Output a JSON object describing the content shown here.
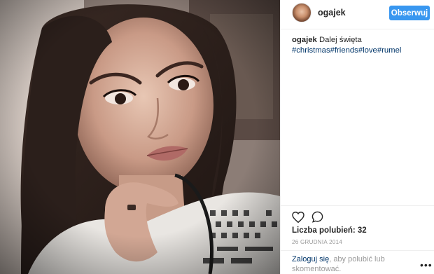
{
  "post": {
    "username": "ogajek",
    "follow_label": "Obserwuj",
    "caption": {
      "username": "ogajek",
      "text": "Dalej święta",
      "hashtags": [
        "#christmas",
        "#friends",
        "#love",
        "#rumel"
      ]
    },
    "likes_label": "Liczba polubień: 32",
    "date": "26 GRUDNIA 2014",
    "login_prompt": {
      "link": "Zaloguj się",
      "text": ", aby polubić lub skomentować."
    },
    "more_icon": "ellipsis-icon"
  },
  "icons": {
    "like": "heart-icon",
    "comment": "comment-icon",
    "more": "ellipsis-icon"
  },
  "colors": {
    "follow_button": "#3897f0",
    "hashtag": "#003569",
    "muted": "#999999"
  }
}
